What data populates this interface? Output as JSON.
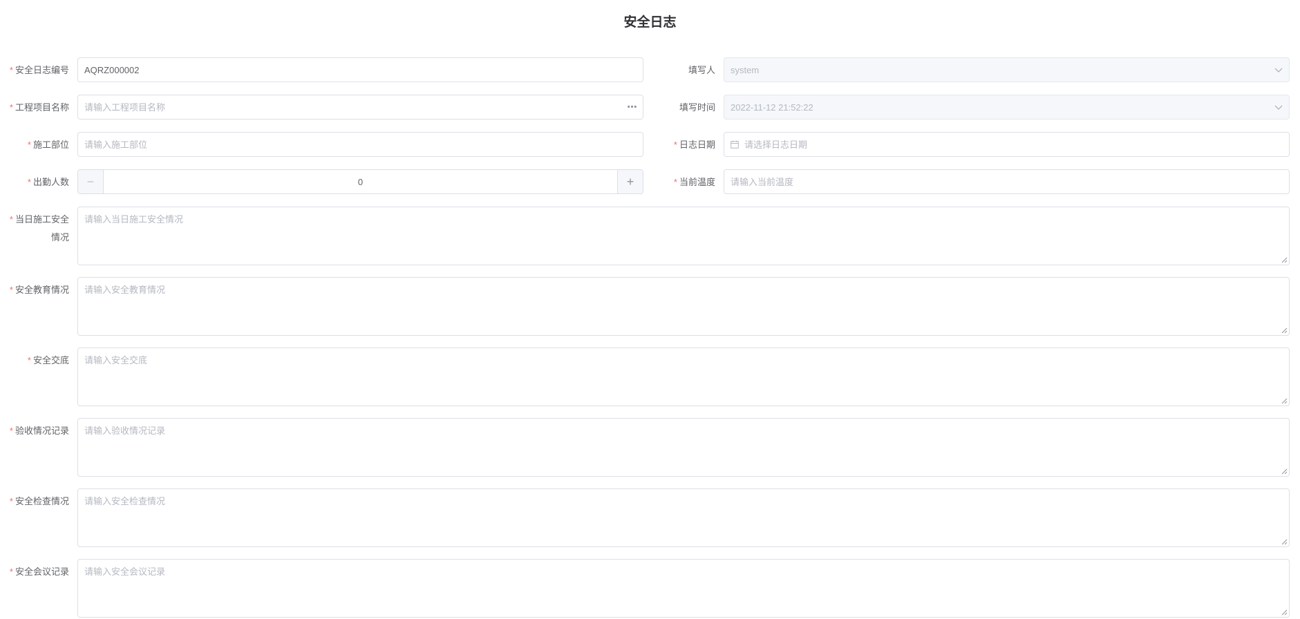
{
  "title": "安全日志",
  "required_mark": "*",
  "fields": {
    "log_no": {
      "label": "安全日志编号",
      "value": "AQRZ000002"
    },
    "writer": {
      "label": "填写人",
      "value": "system"
    },
    "project": {
      "label": "工程项目名称",
      "placeholder": "请输入工程项目名称"
    },
    "write_time": {
      "label": "填写时间",
      "value": "2022-11-12 21:52:22"
    },
    "part": {
      "label": "施工部位",
      "placeholder": "请输入施工部位"
    },
    "log_date": {
      "label": "日志日期",
      "placeholder": "请选择日志日期"
    },
    "attendance": {
      "label": "出勤人数",
      "value": "0",
      "minus": "−",
      "plus": "+"
    },
    "temperature": {
      "label": "当前温度",
      "placeholder": "请输入当前温度"
    },
    "daily_safety": {
      "label_line1": "当日施工安全",
      "label_line2": "情况",
      "placeholder": "请输入当日施工安全情况"
    },
    "education": {
      "label": "安全教育情况",
      "placeholder": "请输入安全教育情况"
    },
    "briefing": {
      "label": "安全交底",
      "placeholder": "请输入安全交底"
    },
    "acceptance": {
      "label": "验收情况记录",
      "placeholder": "请输入验收情况记录"
    },
    "inspection": {
      "label": "安全检查情况",
      "placeholder": "请输入安全检查情况"
    },
    "meeting": {
      "label": "安全会议记录",
      "placeholder": "请输入安全会议记录"
    }
  },
  "icons": {
    "dropdown": "chevron-down-icon",
    "more": "more-dots-icon",
    "calendar": "calendar-icon",
    "resize": "resize-grip-icon"
  }
}
